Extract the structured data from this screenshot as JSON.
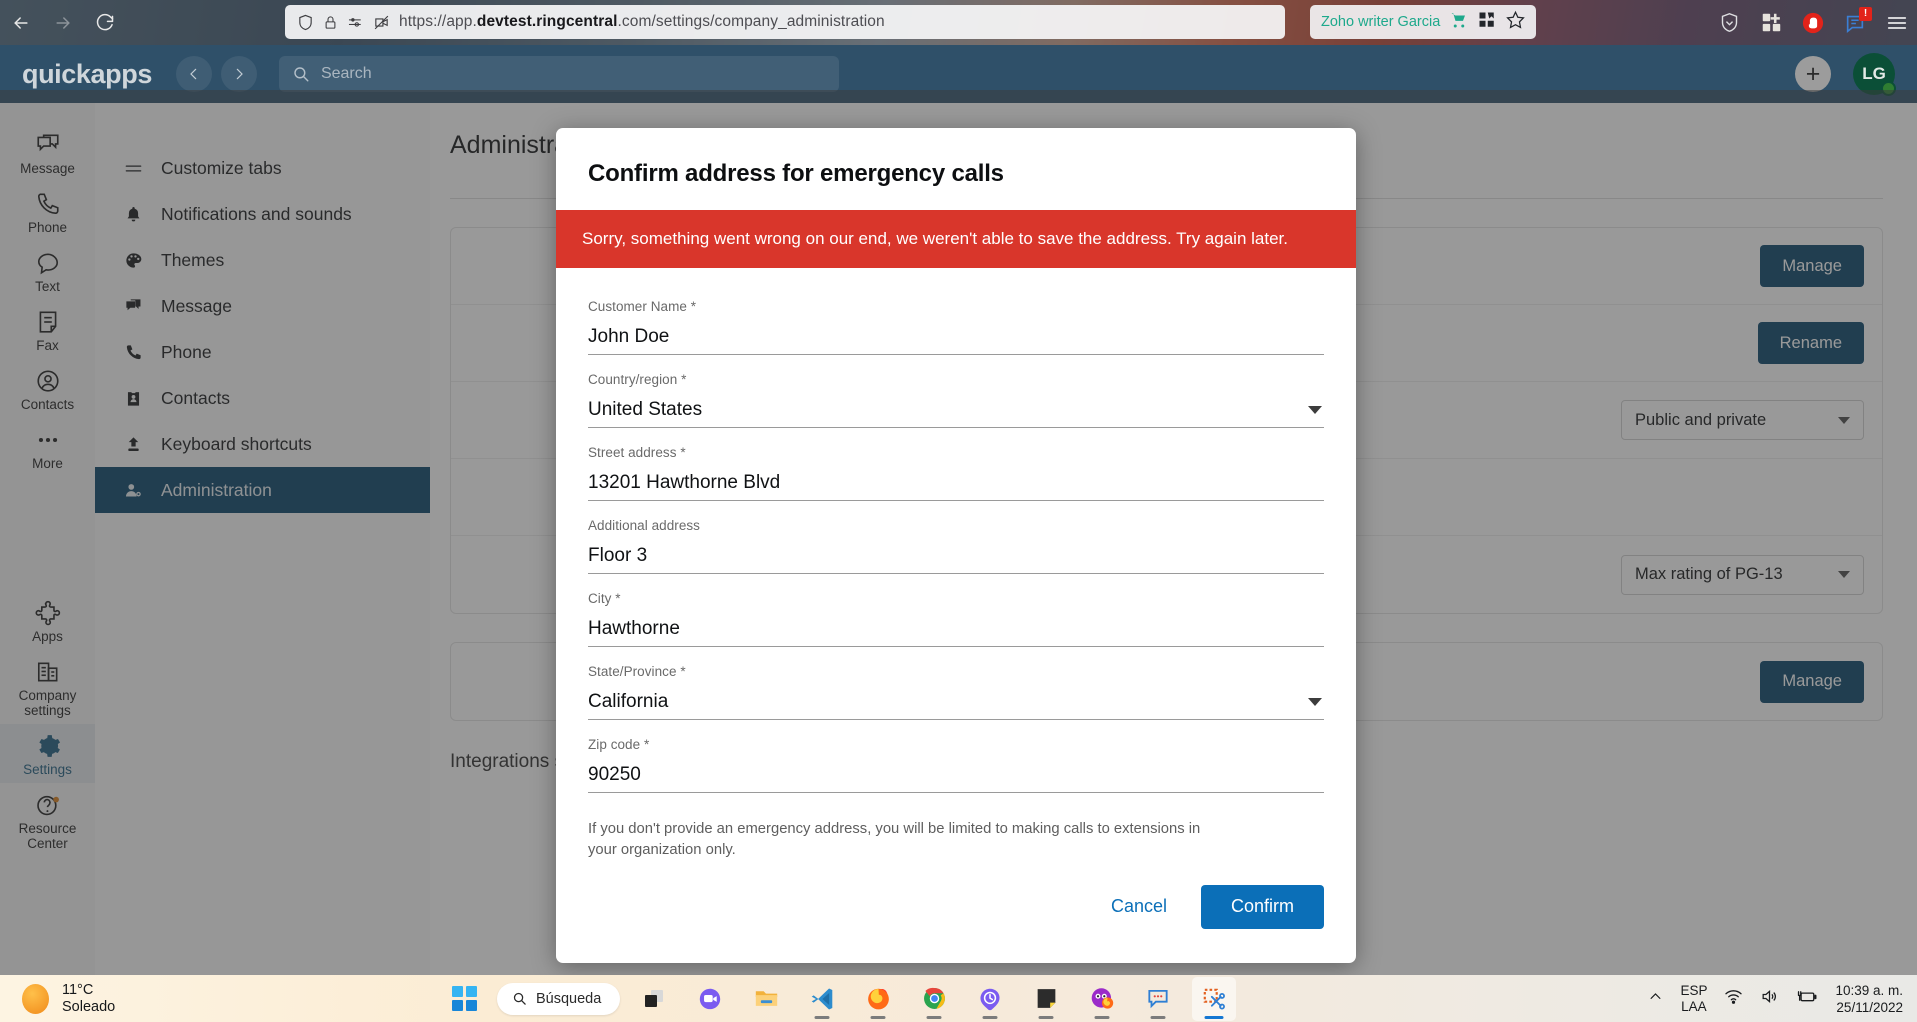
{
  "browser": {
    "url_prefix": "https://app.",
    "url_domain": "devtest.ringcentral",
    "url_suffix": ".com/settings/company_administration",
    "url_full": "https://app.devtest.ringcentral.com/settings/company_administration",
    "profile_name": "Zoho writer Garcia",
    "notification_badge": "!"
  },
  "app": {
    "brand": "quickapps",
    "search_placeholder": "Search",
    "avatar_initials": "LG",
    "rail": [
      {
        "label": "Message",
        "icon": "message-icon"
      },
      {
        "label": "Phone",
        "icon": "phone-icon"
      },
      {
        "label": "Text",
        "icon": "text-icon"
      },
      {
        "label": "Fax",
        "icon": "fax-icon"
      },
      {
        "label": "Contacts",
        "icon": "contacts-icon"
      },
      {
        "label": "More",
        "icon": "more-icon"
      }
    ],
    "rail_bottom": [
      {
        "label": "Apps",
        "icon": "apps-icon",
        "active": false
      },
      {
        "label": "Company settings",
        "icon": "company-settings-icon",
        "active": false
      },
      {
        "label": "Settings",
        "icon": "gear-icon",
        "active": true
      },
      {
        "label": "Resource Center",
        "icon": "help-icon",
        "active": false
      }
    ],
    "settings_nav": [
      {
        "label": "Customize tabs",
        "icon": "list-icon",
        "active": false
      },
      {
        "label": "Notifications and sounds",
        "icon": "bell-icon",
        "active": false
      },
      {
        "label": "Themes",
        "icon": "palette-icon",
        "active": false
      },
      {
        "label": "Message",
        "icon": "message-icon",
        "active": false
      },
      {
        "label": "Phone",
        "icon": "phone-icon",
        "active": false
      },
      {
        "label": "Contacts",
        "icon": "contacts-icon",
        "active": false
      },
      {
        "label": "Keyboard shortcuts",
        "icon": "keyboard-icon",
        "active": false
      },
      {
        "label": "Administration",
        "icon": "admin-user-icon",
        "active": true
      }
    ],
    "page_title": "Administration",
    "background": {
      "manage_label": "Manage",
      "rename_label": "Rename",
      "visibility_value": "Public and private",
      "rating_value": "Max rating of PG-13",
      "manage2_label": "Manage",
      "integrations_label": "Integrations settings"
    }
  },
  "modal": {
    "title": "Confirm address for emergency calls",
    "error": "Sorry, something went wrong on our end, we weren't able to save the address. Try again later.",
    "fields": [
      {
        "label": "Customer Name",
        "required": true,
        "value": "John Doe",
        "type": "text"
      },
      {
        "label": "Country/region",
        "required": true,
        "value": "United States",
        "type": "select"
      },
      {
        "label": "Street address",
        "required": true,
        "value": "13201 Hawthorne Blvd",
        "type": "text"
      },
      {
        "label": "Additional address",
        "required": false,
        "value": "Floor 3",
        "type": "text"
      },
      {
        "label": "City",
        "required": true,
        "value": "Hawthorne",
        "type": "text"
      },
      {
        "label": "State/Province",
        "required": true,
        "value": "California",
        "type": "select"
      },
      {
        "label": "Zip code",
        "required": true,
        "value": "90250",
        "type": "text"
      }
    ],
    "note": "If you don't provide an emergency address, you will be limited to making calls to extensions in your organization only.",
    "cancel_label": "Cancel",
    "confirm_label": "Confirm"
  },
  "taskbar": {
    "weather_temp": "11°C",
    "weather_cond": "Soleado",
    "search_label": "Búsqueda",
    "language_line1": "ESP",
    "language_line2": "LAA",
    "clock_time": "10:39 a. m.",
    "clock_date": "25/11/2022",
    "apps": [
      {
        "name": "task-view-icon",
        "running": false,
        "focused": false
      },
      {
        "name": "chat-video-icon",
        "running": false,
        "focused": false
      },
      {
        "name": "file-explorer-icon",
        "running": false,
        "focused": false
      },
      {
        "name": "vscode-icon",
        "running": true,
        "focused": false
      },
      {
        "name": "firefox-icon",
        "running": true,
        "focused": false
      },
      {
        "name": "chrome-icon",
        "running": true,
        "focused": false
      },
      {
        "name": "clock-app-icon",
        "running": true,
        "focused": false
      },
      {
        "name": "sticky-notes-icon",
        "running": true,
        "focused": false
      },
      {
        "name": "firefox-dev-icon",
        "running": true,
        "focused": false
      },
      {
        "name": "feedback-icon",
        "running": true,
        "focused": false
      },
      {
        "name": "snipping-tool-icon",
        "running": true,
        "focused": true
      }
    ]
  },
  "colors": {
    "app_header": "#2f5069",
    "nav_active": "#064268",
    "error_red": "#d9362b",
    "primary_blue": "#0b6fb8"
  }
}
